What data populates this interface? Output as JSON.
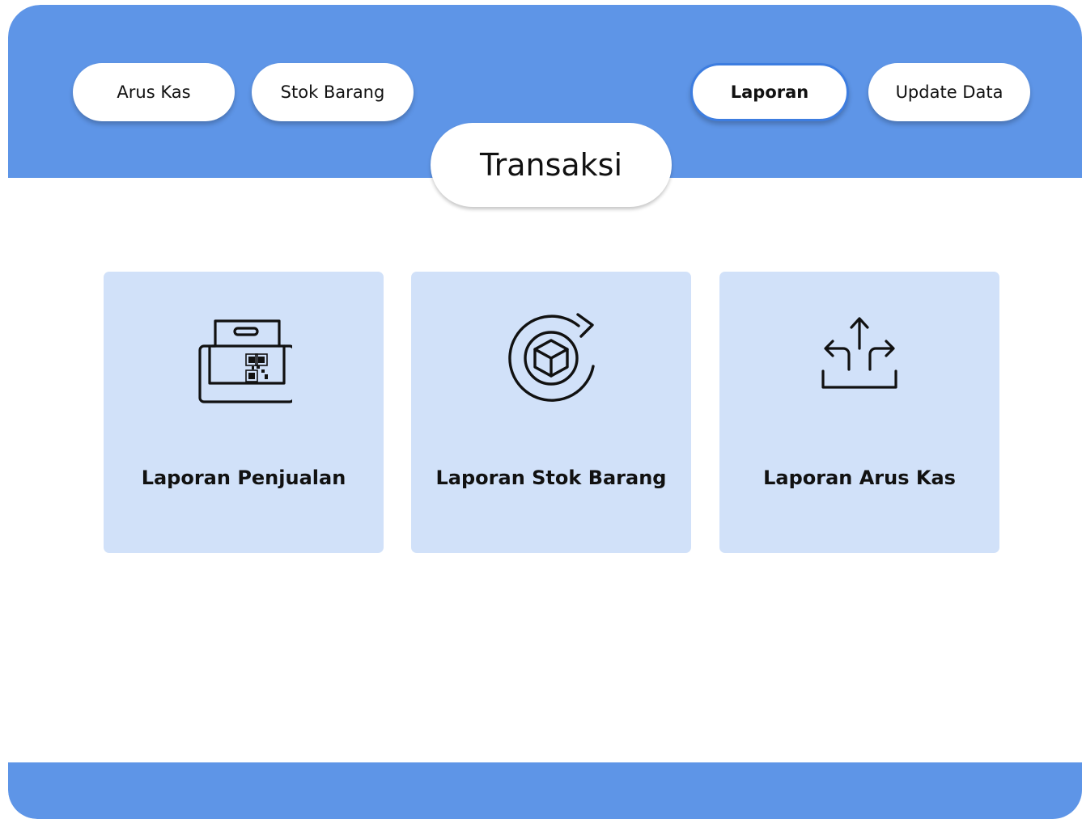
{
  "nav": {
    "arus_kas": "Arus Kas",
    "stok_barang": "Stok Barang",
    "laporan": "Laporan",
    "update_data": "Update Data"
  },
  "title": "Transaksi",
  "cards": [
    {
      "label": "Laporan Penjualan",
      "icon": "cash-register-qr-icon"
    },
    {
      "label": "Laporan Stok Barang",
      "icon": "box-refresh-icon"
    },
    {
      "label": "Laporan Arus Kas",
      "icon": "split-arrows-icon"
    }
  ],
  "colors": {
    "primary": "#5e95e7",
    "card_background": "#d1e1f9",
    "active_border": "#3d7de0",
    "text": "#111111"
  }
}
